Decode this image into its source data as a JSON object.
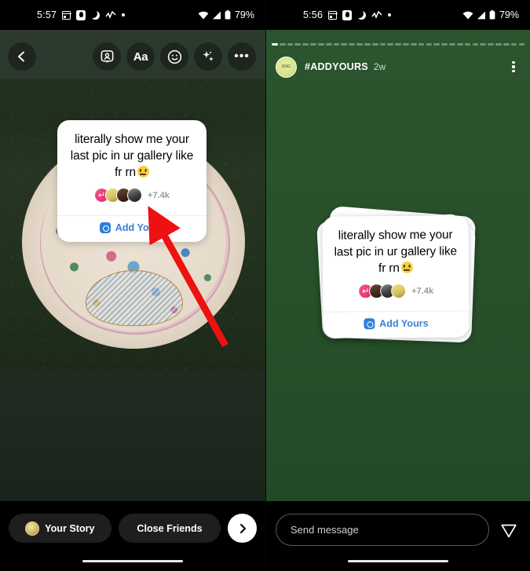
{
  "left": {
    "status": {
      "time": "5:57",
      "battery": "79%",
      "icons": [
        "calendar-icon",
        "app-icon",
        "do-not-disturb-moon-icon",
        "activity-pulse-icon",
        "dot-icon"
      ],
      "right_icons": [
        "wifi-icon",
        "cellular-signal-icon",
        "battery-icon"
      ]
    },
    "toolbar": {
      "back_label": "‹",
      "items": [
        {
          "name": "add-story-tag-icon",
          "label": ""
        },
        {
          "name": "text-tool-icon",
          "label": "Aa"
        },
        {
          "name": "sticker-icon",
          "label": ""
        },
        {
          "name": "effects-sparkle-icon",
          "label": ""
        },
        {
          "name": "more-options-icon",
          "label": "•••"
        }
      ]
    },
    "sticker": {
      "text": "literally show me your last pic in ur gallery like fr rn",
      "emoji": "neutral-face",
      "participants_count": "+7.4k",
      "add_yours_label": "Add Yours"
    },
    "annotation": {
      "type": "red-arrow",
      "points_to": "Add Yours"
    },
    "bottom": {
      "your_story_label": "Your Story",
      "close_friends_label": "Close Friends",
      "next_label": "›"
    }
  },
  "right": {
    "status": {
      "time": "5:56",
      "battery": "79%"
    },
    "header": {
      "username": "#ADDYOURS",
      "timestamp": "2w",
      "avatar_label": "ENG",
      "more_icon": "kebab-menu-icon"
    },
    "progress": {
      "segments": 33,
      "active_index": 0
    },
    "sticker": {
      "text": "literally show me your last pic in ur gallery like fr rn",
      "emoji": "neutral-face",
      "participants_count": "+7.4k",
      "add_yours_label": "Add Yours"
    },
    "bottom": {
      "message_placeholder": "Send message",
      "send_icon": "send-paper-plane-icon"
    }
  },
  "colors": {
    "accent_blue": "#3b7fd4",
    "story_bg_green": "#28512b",
    "bar_black": "#000000",
    "annotation_red": "#ee1111"
  }
}
